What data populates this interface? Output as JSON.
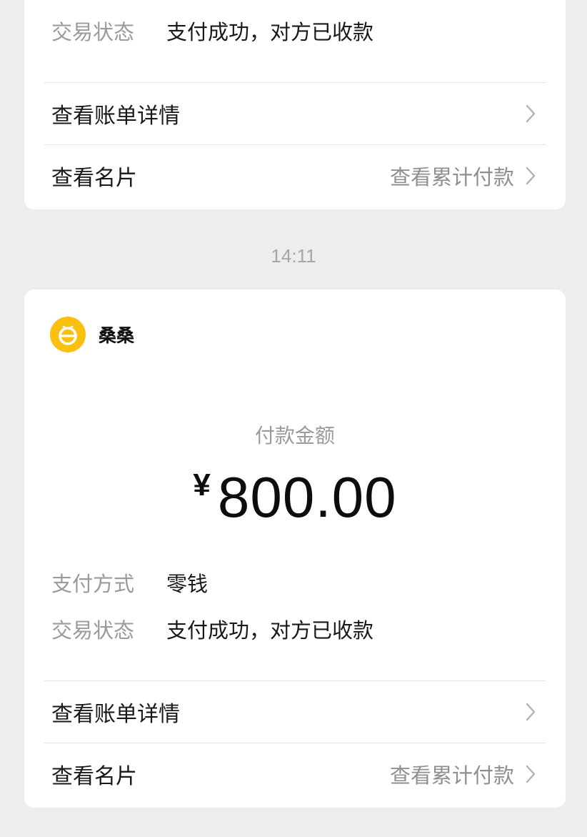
{
  "top_card": {
    "status_label": "交易状态",
    "status_value": "支付成功，对方已收款",
    "bill_detail_label": "查看账单详情",
    "business_card_label": "查看名片",
    "cumulative_payment_label": "查看累计付款"
  },
  "timestamp": "14:11",
  "payment_card": {
    "merchant_name": "桑桑",
    "amount_label": "付款金额",
    "currency_symbol": "¥",
    "amount": "800.00",
    "method_label": "支付方式",
    "method_value": "零钱",
    "status_label": "交易状态",
    "status_value": "支付成功，对方已收款",
    "bill_detail_label": "查看账单详情",
    "business_card_label": "查看名片",
    "cumulative_payment_label": "查看累计付款"
  },
  "colors": {
    "background": "#ededed",
    "card": "#ffffff",
    "merchant_logo": "#f9c010"
  },
  "icons": [
    "chevron-right-icon",
    "merchant-logo-icon"
  ]
}
